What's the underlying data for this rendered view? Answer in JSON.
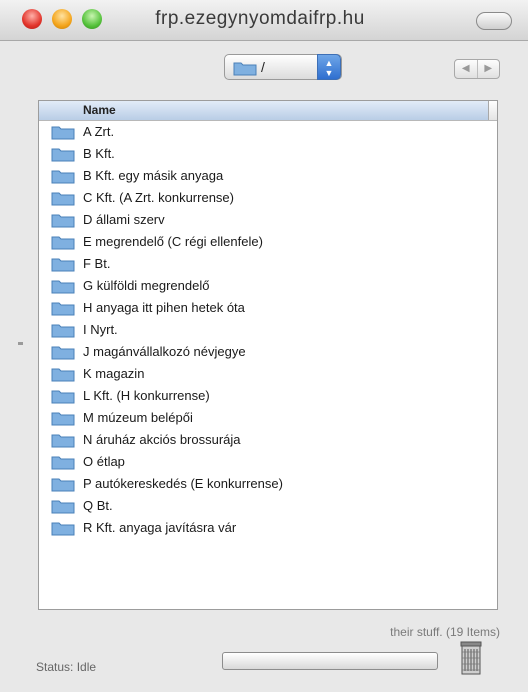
{
  "window": {
    "title": "frp.ezegynyomdaifrp.hu"
  },
  "path_popup": {
    "label": "/",
    "icon": "folder-icon"
  },
  "nav": {
    "back": "◀",
    "forward": "▶"
  },
  "list": {
    "column_header": "Name",
    "items": [
      "A Zrt.",
      "B Kft.",
      "B Kft. egy másik anyaga",
      "C Kft. (A Zrt. konkurrense)",
      "D állami szerv",
      "E megrendelő (C régi ellenfele)",
      "F Bt.",
      "G külföldi megrendelő",
      "H anyaga itt pihen hetek óta",
      "I Nyrt.",
      "J magánvállalkozó névjegye",
      "K magazin",
      "L Kft. (H konkurrense)",
      "M múzeum belépői",
      "N áruház akciós brossurája",
      "O étlap",
      "P autókereskedés (E konkurrense)",
      "Q Bt.",
      "R Kft. anyaga javításra vár"
    ]
  },
  "item_count": "their stuff. (19 Items)",
  "status": "Status: Idle",
  "progress": 0,
  "colors": {
    "folder": "#7fb0e0",
    "accent": "#3a78d4"
  }
}
